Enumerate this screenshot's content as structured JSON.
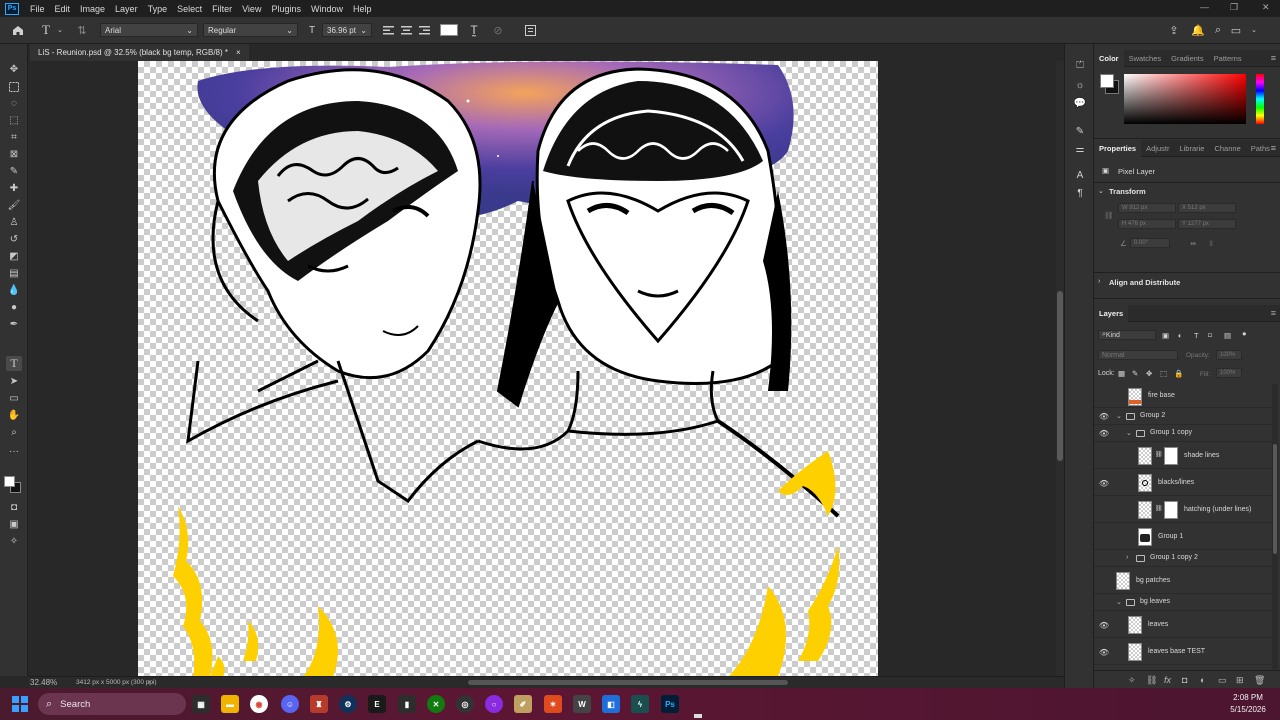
{
  "menu": {
    "logo": "Ps",
    "items": [
      "File",
      "Edit",
      "Image",
      "Layer",
      "Type",
      "Select",
      "Filter",
      "View",
      "Plugins",
      "Window",
      "Help"
    ]
  },
  "options": {
    "font_family": "Arial",
    "font_style": "Regular",
    "font_size": "36.96 pt"
  },
  "document": {
    "tab_title": "LiS - Reunion.psd @ 32.5% (black bg temp, RGB/8) *",
    "close": "×"
  },
  "status": {
    "zoom": "32.48%",
    "doc_size": "3412 px x 5000 px (300 ppi)"
  },
  "color_panel": {
    "tabs": [
      "Color",
      "Swatches",
      "Gradients",
      "Patterns"
    ],
    "fg_color": "#ffffff",
    "bg_color": "#111111"
  },
  "properties_panel": {
    "tabs": [
      "Properties",
      "Adjustr",
      "Librarie",
      "Channe",
      "Paths"
    ],
    "kind": "Pixel Layer",
    "transform_title": "Transform",
    "w": "W  912 px",
    "x": "X  512 px",
    "h": "H  476 px",
    "y": "Y  1277 px",
    "angle": "0.00°",
    "align_title": "Align and Distribute"
  },
  "layers_panel": {
    "title": "Layers",
    "filter": "Kind",
    "blend_mode": "Normal",
    "opacity_label": "Opacity:",
    "opacity_value": "100%",
    "lock_label": "Lock:",
    "fill_label": "Fill:",
    "fill_value": "100%",
    "rows": [
      {
        "name": "fire base",
        "visible": false
      },
      {
        "name": "Group 2",
        "visible": true
      },
      {
        "name": "Group 1 copy",
        "visible": true
      },
      {
        "name": "shade lines",
        "visible": false
      },
      {
        "name": "blacks/lines",
        "visible": true
      },
      {
        "name": "hatching (under lines)",
        "visible": false
      },
      {
        "name": "Group 1",
        "visible": false
      },
      {
        "name": "Group 1 copy 2",
        "visible": false
      },
      {
        "name": "bg patches",
        "visible": false
      },
      {
        "name": "bg leaves",
        "visible": false
      },
      {
        "name": "leaves",
        "visible": true
      },
      {
        "name": "leaves base TEST",
        "visible": true
      }
    ]
  },
  "taskbar": {
    "search": "Search",
    "time": "2:08 PM",
    "date": "5/15/2026"
  }
}
